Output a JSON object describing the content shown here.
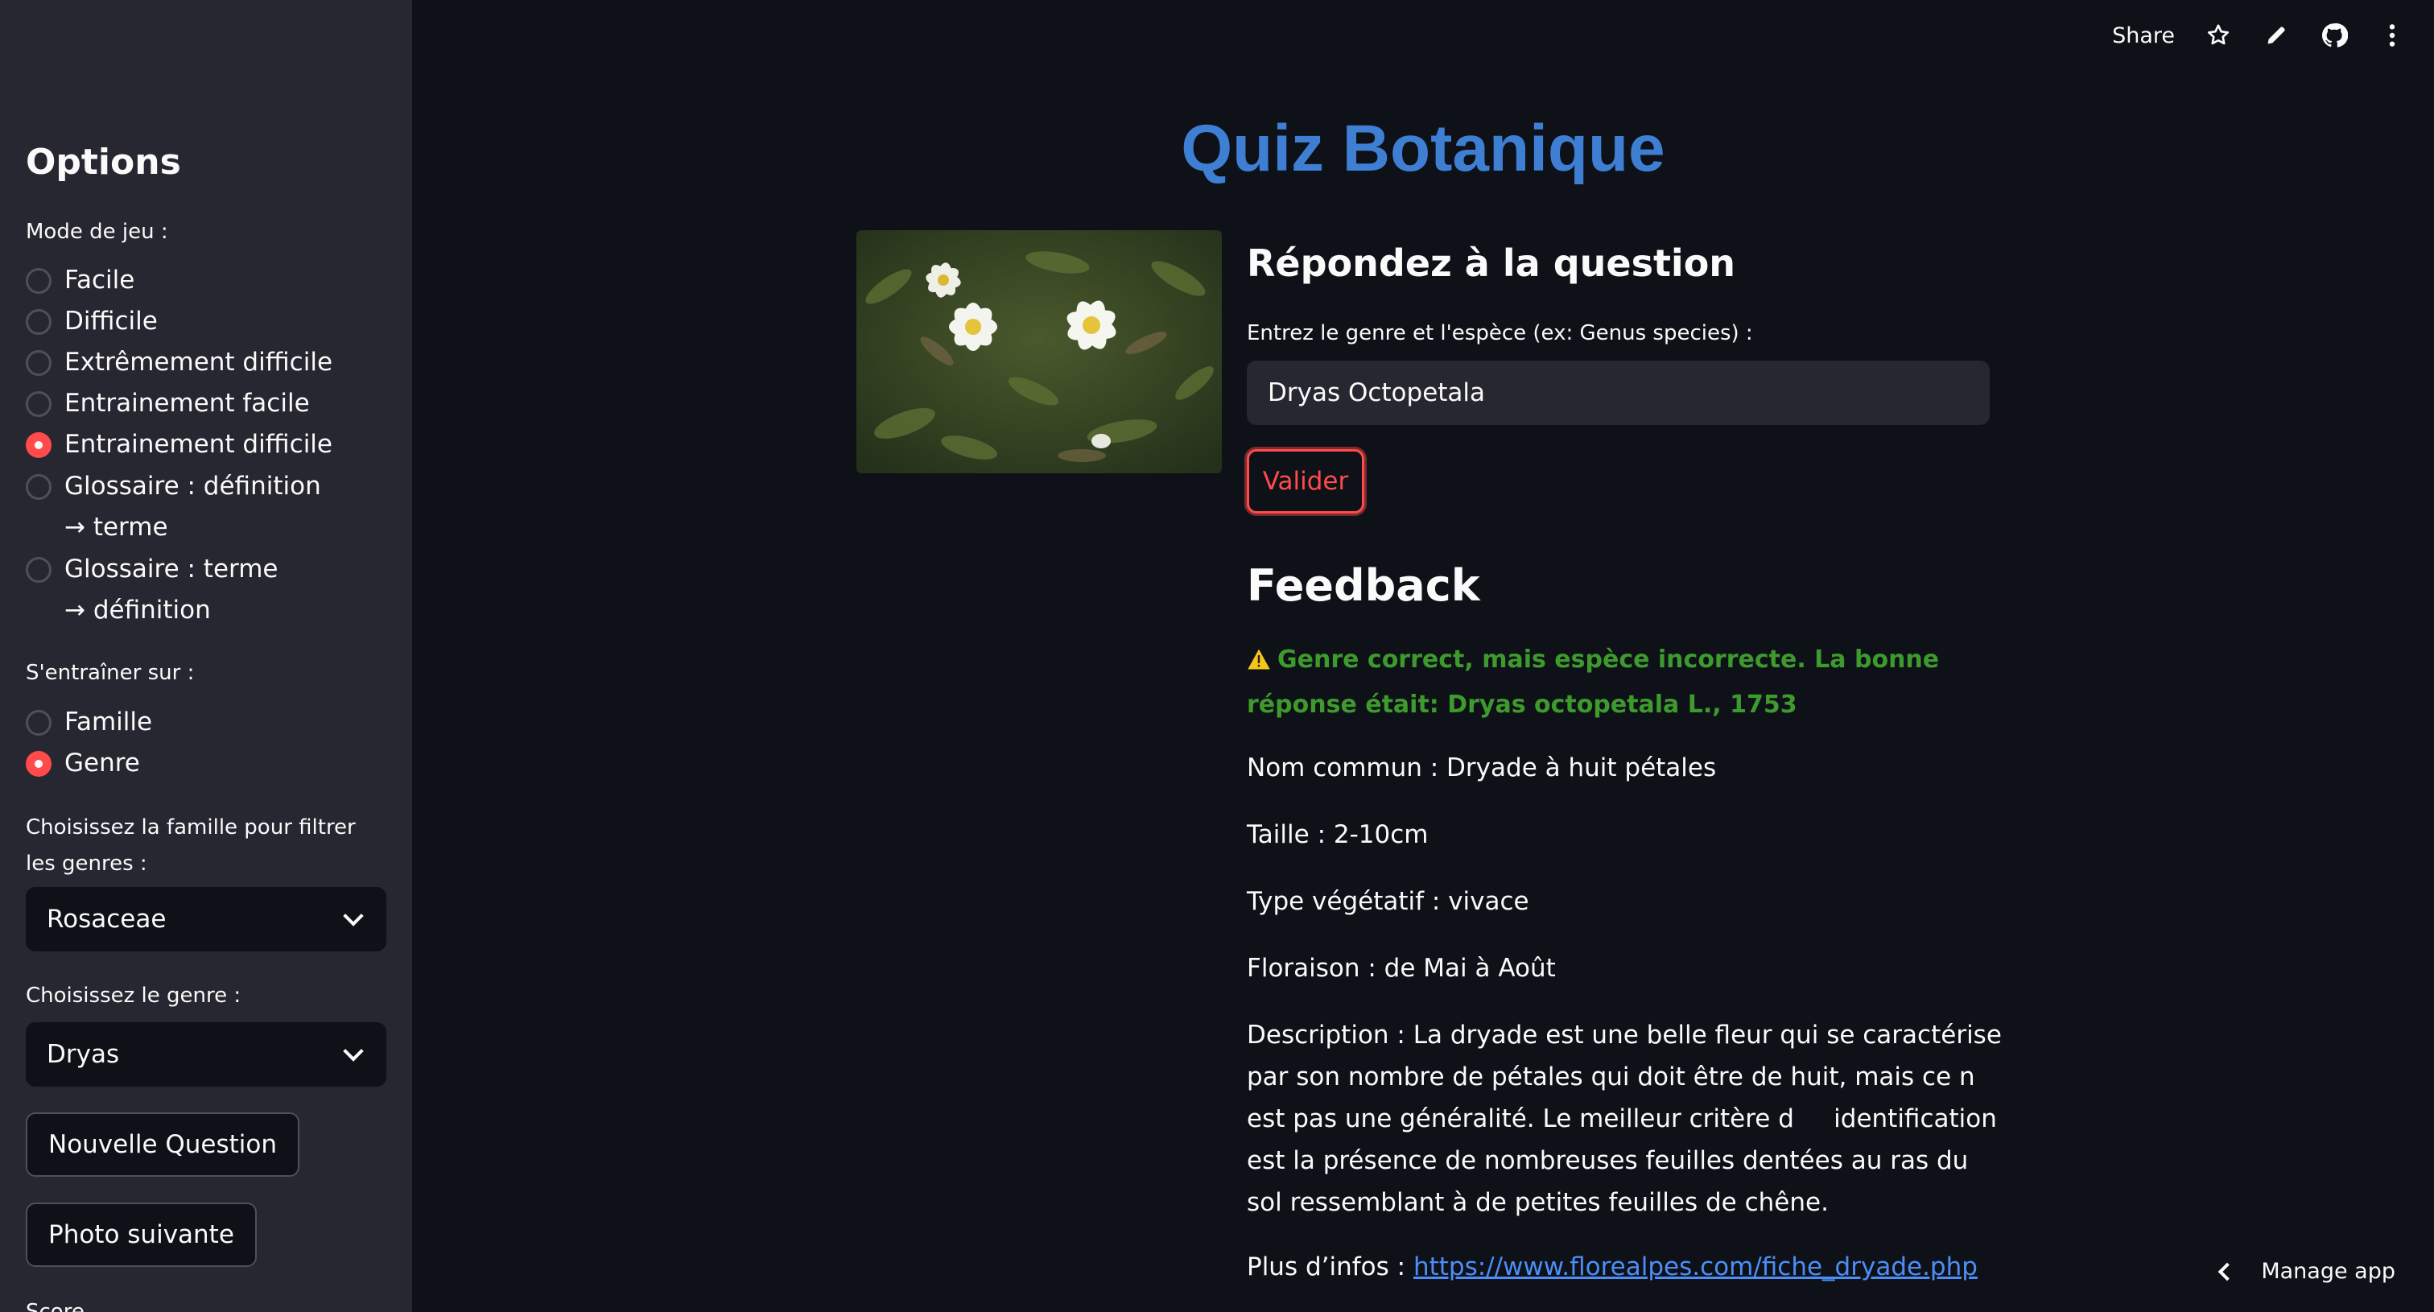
{
  "sidebar": {
    "title": "Options",
    "game_mode_label": "Mode de jeu :",
    "game_modes": [
      {
        "label": "Facile",
        "selected": false
      },
      {
        "label": "Difficile",
        "selected": false
      },
      {
        "label": "Extrêmement difficile",
        "selected": false
      },
      {
        "label": "Entrainement facile",
        "selected": false
      },
      {
        "label": "Entrainement difficile",
        "selected": true
      },
      {
        "label": "Glossaire : définition → terme",
        "selected": false
      },
      {
        "label": "Glossaire : terme → définition",
        "selected": false
      }
    ],
    "train_on_label": "S'entraîner sur :",
    "train_on": [
      {
        "label": "Famille",
        "selected": false
      },
      {
        "label": "Genre",
        "selected": true
      }
    ],
    "family_select_label": "Choisissez la famille pour filtrer les genres :",
    "family_value": "Rosaceae",
    "genus_select_label": "Choisissez le genre :",
    "genus_value": "Dryas",
    "new_question_label": "Nouvelle Question",
    "next_photo_label": "Photo suivante",
    "score_label": "Score"
  },
  "toolbar": {
    "share_label": "Share",
    "icons": [
      "star-icon",
      "pencil-icon",
      "github-icon",
      "more-vertical-icon"
    ]
  },
  "main": {
    "title": "Quiz Botanique",
    "question_heading": "Répondez à la question",
    "input_label": "Entrez le genre et l'espèce (ex: Genus species) :",
    "input_value": "Dryas Octopetala",
    "validate_label": "Valider",
    "feedback_heading": "Feedback",
    "feedback_warning": "Genre correct, mais espèce incorrecte. La bonne réponse était: Dryas octopetala L., 1753",
    "common_name": "Nom commun : Dryade à huit pétales",
    "size": "Taille : 2-10cm",
    "veg_type": "Type végétatif : vivace",
    "flowering": "Floraison : de Mai à Août",
    "description": "Description : La dryade est une belle fleur qui se caractérise par son nombre de pétales qui doit être de huit, mais ce n     est pas une généralité. Le meilleur critère d     identification est la présence de nombreuses feuilles dentées au ras du sol ressemblant à de petites feuilles de chêne.",
    "more_info_prefix": "Plus d’infos : ",
    "more_info_link": "https://www.florealpes.com/fiche_dryade.php"
  },
  "footer": {
    "manage_app_label": "Manage app"
  },
  "colors": {
    "accent": "#ff4b4b",
    "title_blue": "#3e7fd4",
    "success_green": "#3d9a2c",
    "link_blue": "#4c8ef7",
    "sidebar_bg": "#262730",
    "main_bg": "#0e1117"
  }
}
